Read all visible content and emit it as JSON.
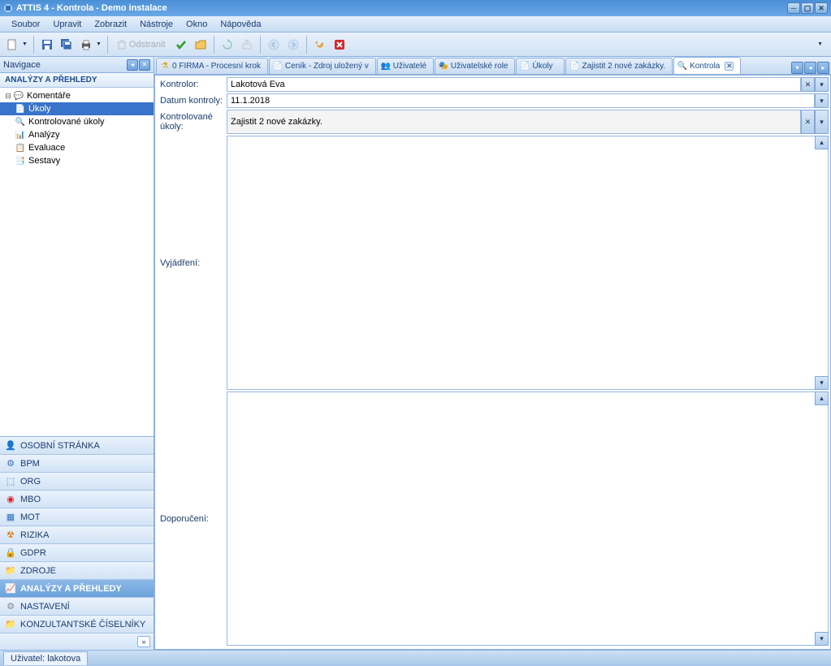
{
  "window": {
    "title": "ATTIS 4 - Kontrola - Demo instalace"
  },
  "menu": {
    "items": [
      "Soubor",
      "Upravit",
      "Zobrazit",
      "Nástroje",
      "Okno",
      "Nápověda"
    ]
  },
  "toolbar": {
    "odstranit": "Odstranit"
  },
  "nav": {
    "title": "Navigace",
    "section_title": "ANALÝZY A PŘEHLEDY",
    "tree": [
      {
        "label": "Komentáře",
        "icon": "comment",
        "selected": false
      },
      {
        "label": "Úkoly",
        "icon": "task",
        "selected": true
      },
      {
        "label": "Kontrolované úkoly",
        "icon": "search",
        "selected": false
      },
      {
        "label": "Analýzy",
        "icon": "chart",
        "selected": false
      },
      {
        "label": "Evaluace",
        "icon": "eval",
        "selected": false
      },
      {
        "label": "Sestavy",
        "icon": "report",
        "selected": false
      }
    ],
    "sections": [
      {
        "label": "OSOBNÍ STRÁNKA",
        "icon": "person",
        "active": false
      },
      {
        "label": "BPM",
        "icon": "bpm",
        "active": false
      },
      {
        "label": "ORG",
        "icon": "org",
        "active": false
      },
      {
        "label": "MBO",
        "icon": "mbo",
        "active": false
      },
      {
        "label": "MOT",
        "icon": "mot",
        "active": false
      },
      {
        "label": "RIZIKA",
        "icon": "risk",
        "active": false
      },
      {
        "label": "GDPR",
        "icon": "gdpr",
        "active": false
      },
      {
        "label": "ZDROJE",
        "icon": "folder",
        "active": false
      },
      {
        "label": "ANALÝZY A PŘEHLEDY",
        "icon": "analyze",
        "active": true
      },
      {
        "label": "NASTAVENÍ",
        "icon": "gear",
        "active": false
      },
      {
        "label": "KONZULTANTSKÉ ČÍSELNÍKY",
        "icon": "folder",
        "active": false
      }
    ]
  },
  "tabs": [
    {
      "label": "0 FIRMA - Procesní krok",
      "icon": "process",
      "active": false,
      "closeable": false
    },
    {
      "label": "Ceník - Zdroj uložený v",
      "icon": "doc",
      "active": false,
      "closeable": false
    },
    {
      "label": "Uživatelé",
      "icon": "users",
      "active": false,
      "closeable": false
    },
    {
      "label": "Uživatelské role",
      "icon": "roles",
      "active": false,
      "closeable": false
    },
    {
      "label": "Úkoly",
      "icon": "task",
      "active": false,
      "closeable": false
    },
    {
      "label": "Zajistit 2 nové zakázky.",
      "icon": "task",
      "active": false,
      "closeable": false
    },
    {
      "label": "Kontrola",
      "icon": "search",
      "active": true,
      "closeable": true
    }
  ],
  "form": {
    "kontrolor": {
      "label": "Kontrolor:",
      "value": "Lakotová Eva"
    },
    "datum": {
      "label": "Datum kontroly:",
      "value": "11.1.2018"
    },
    "ukoly": {
      "label": "Kontrolované úkoly:",
      "value": "Zajistit 2 nové zakázky."
    },
    "vyjadreni": {
      "label": "Vyjádření:",
      "value": ""
    },
    "doporuceni": {
      "label": "Doporučení:",
      "value": ""
    }
  },
  "status": {
    "user_label": "Uživatel: lakotova"
  }
}
